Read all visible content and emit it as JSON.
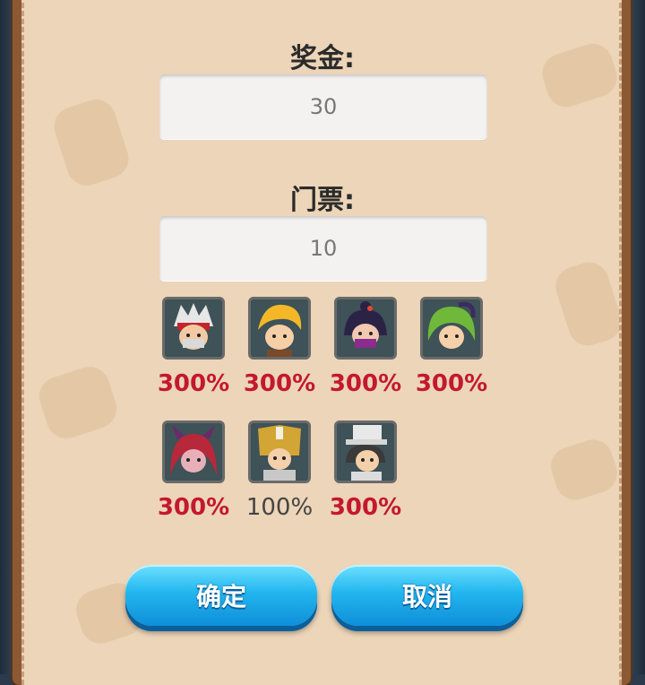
{
  "reward": {
    "label": "奖金:",
    "value": "30"
  },
  "ticket": {
    "label": "门票:",
    "value": "10"
  },
  "heroes": [
    {
      "name": "white-hair-ninja",
      "percent": "300%",
      "highlight": true
    },
    {
      "name": "blonde-swordsman",
      "percent": "300%",
      "highlight": true
    },
    {
      "name": "masked-kunoichi",
      "percent": "300%",
      "highlight": true
    },
    {
      "name": "green-tentacle-elf",
      "percent": "300%",
      "highlight": true
    },
    {
      "name": "red-horned-demoness",
      "percent": "300%",
      "highlight": true
    },
    {
      "name": "golden-armored-knight",
      "percent": "100%",
      "highlight": false
    },
    {
      "name": "top-hat-gentleman",
      "percent": "300%",
      "highlight": true
    }
  ],
  "buttons": {
    "confirm": "确定",
    "cancel": "取消"
  },
  "colors": {
    "highlight_percent": "#c4182e",
    "plain_percent": "#444444",
    "button_blue": "#22b6ef",
    "panel_bg": "#ecd5b8"
  }
}
